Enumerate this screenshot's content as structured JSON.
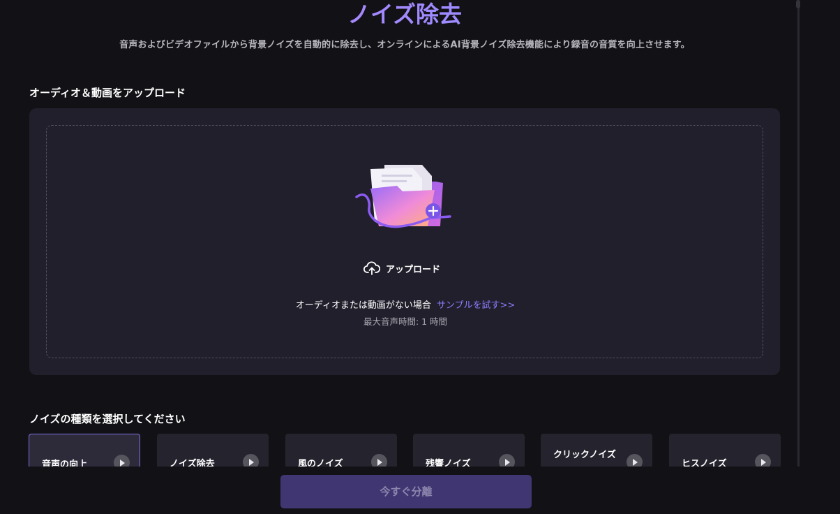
{
  "header": {
    "title": "ノイズ除去",
    "subtitle": "音声およびビデオファイルから背景ノイズを自動的に除去し、オンラインによるAI背景ノイズ除去機能により録音の音質を向上させます。"
  },
  "upload_section": {
    "heading": "オーディオ＆動画をアップロード",
    "upload_label": "アップロード",
    "no_media_text": "オーディオまたは動画がない場合",
    "sample_link": "サンプルを試す>>",
    "max_duration": "最大音声時間: 1 時間"
  },
  "noise_section": {
    "heading": "ノイズの種類を選択してください",
    "cards": [
      {
        "label": "音声の向上",
        "selected": true
      },
      {
        "label": "ノイズ除去",
        "selected": false
      },
      {
        "label": "風のノイズ",
        "selected": false
      },
      {
        "label": "残響ノイズ",
        "selected": false
      },
      {
        "label": "クリックノイズ",
        "selected": false
      },
      {
        "label": "ヒスノイズ",
        "selected": false
      }
    ]
  },
  "footer": {
    "separate_button": "今すぐ分離"
  },
  "colors": {
    "background": "#121115",
    "panel": "#201f2b",
    "accent": "#8b7cff",
    "button_disabled": "#3f3672"
  }
}
